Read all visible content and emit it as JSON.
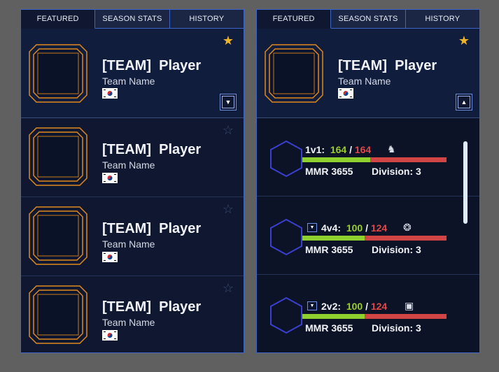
{
  "tabs": [
    "FEATURED",
    "SEASON STATS",
    "HISTORY"
  ],
  "left_cards": [
    {
      "team_tag": "[TEAM]",
      "player": "Player",
      "team_name": "Team Name",
      "favorite": true
    },
    {
      "team_tag": "[TEAM]",
      "player": "Player",
      "team_name": "Team Name",
      "favorite": false
    },
    {
      "team_tag": "[TEAM]",
      "player": "Player",
      "team_name": "Team Name",
      "favorite": false
    },
    {
      "team_tag": "[TEAM]",
      "player": "Player",
      "team_name": "Team Name",
      "favorite": false
    }
  ],
  "right_card": {
    "team_tag": "[TEAM]",
    "player": "Player",
    "team_name": "Team Name",
    "favorite": true
  },
  "stats": [
    {
      "mode": "1v1:",
      "wins": "164",
      "losses": "164",
      "win_fraction": 0.47,
      "mmr": "MMR 3655",
      "division": "Division: 3",
      "race_icon": "zerg-icon"
    },
    {
      "mode": "4v4:",
      "wins": "100",
      "losses": "124",
      "win_fraction": 0.43,
      "mmr": "MMR 3655",
      "division": "Division: 3",
      "race_icon": "protoss-icon"
    },
    {
      "mode": "2v2:",
      "wins": "100",
      "losses": "124",
      "win_fraction": 0.43,
      "mmr": "MMR 3655",
      "division": "Division: 3",
      "race_icon": "random-icon"
    }
  ],
  "separator": "/",
  "colors": {
    "accent": "#3f64c8",
    "frame": "#e08a1e",
    "win": "#9acd32",
    "loss": "#e04848",
    "star": "#f0b429"
  }
}
